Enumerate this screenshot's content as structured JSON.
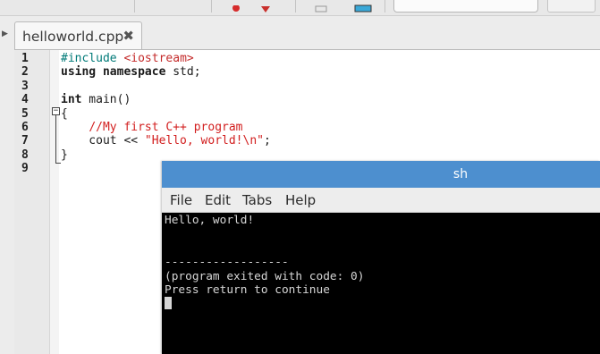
{
  "toolbar": {
    "icons": [
      "toolbar-icon-red",
      "toolbar-icon-run",
      "toolbar-icon-build"
    ],
    "search_placeholder": ""
  },
  "tab": {
    "label": "helloworld.cpp",
    "close_glyph": "✖"
  },
  "editor": {
    "line_numbers": [
      "1",
      "2",
      "3",
      "4",
      "5",
      "6",
      "7",
      "8",
      "9"
    ],
    "fold_glyph": "⊟",
    "code": [
      [
        {
          "t": "#include ",
          "c": "pp"
        },
        {
          "t": "<iostream>",
          "c": "inc"
        }
      ],
      [
        {
          "t": "using namespace",
          "c": "kw"
        },
        {
          "t": " std;",
          "c": ""
        }
      ],
      [],
      [
        {
          "t": "int",
          "c": "kw"
        },
        {
          "t": " main()",
          "c": ""
        }
      ],
      [
        {
          "t": "{",
          "c": ""
        }
      ],
      [
        {
          "t": "    ",
          "c": ""
        },
        {
          "t": "//My first C++ program",
          "c": "cm"
        }
      ],
      [
        {
          "t": "    cout << ",
          "c": ""
        },
        {
          "t": "\"Hello, world!\\n\"",
          "c": "str"
        },
        {
          "t": ";",
          "c": ""
        }
      ],
      [
        {
          "t": "}",
          "c": ""
        }
      ],
      []
    ]
  },
  "terminal": {
    "title": "sh",
    "menu": [
      "File",
      "Edit",
      "Tabs",
      "Help"
    ],
    "lines": [
      "Hello, world!",
      "",
      "",
      "------------------",
      "(program exited with code: 0)",
      "Press return to continue"
    ]
  },
  "colors": {
    "title_bar": "#4d8fcf",
    "terminal_bg": "#000000",
    "comment_string": "#d21e1e",
    "preprocessor": "#007a78"
  }
}
